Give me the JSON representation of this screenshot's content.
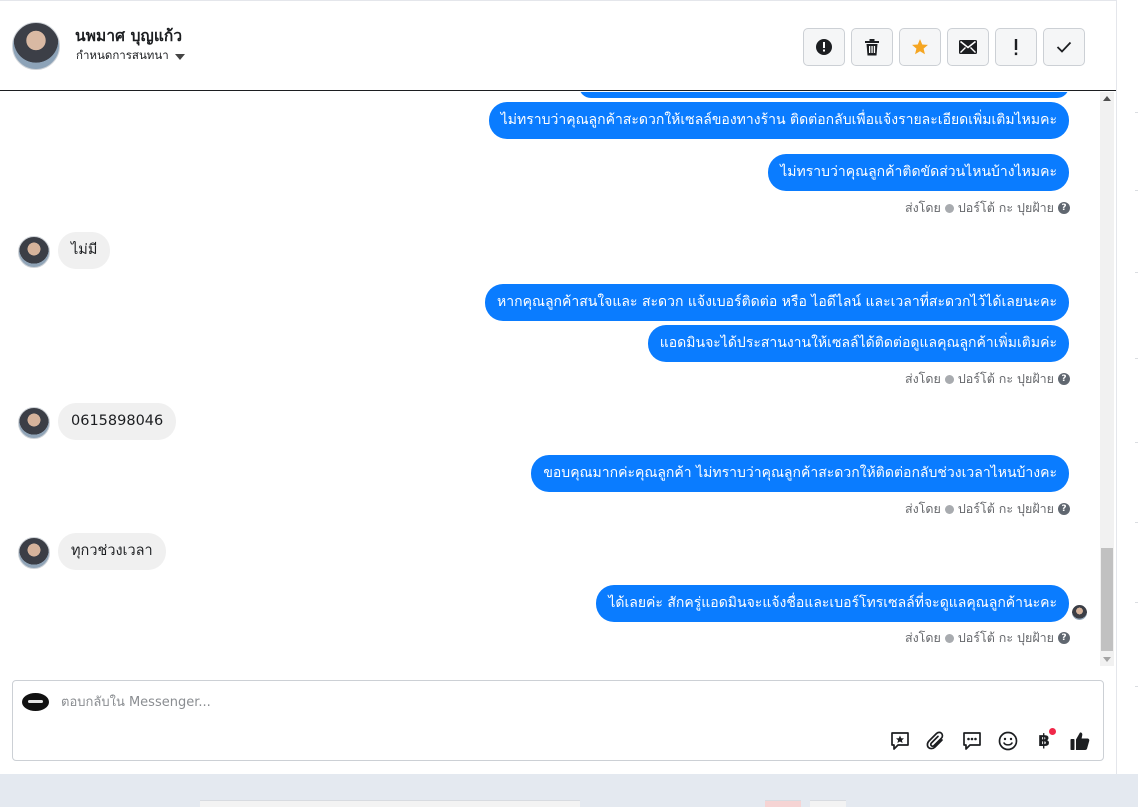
{
  "header": {
    "contact_name": "นพมาศ บุญแก้ว",
    "assign_label": "กำหนดการสนทนา",
    "actions": [
      {
        "name": "spam-button",
        "icon": "alert-circle-icon"
      },
      {
        "name": "delete-button",
        "icon": "trash-icon"
      },
      {
        "name": "star-button",
        "icon": "star-icon",
        "color": "#f5a623"
      },
      {
        "name": "mark-unread-button",
        "icon": "envelope-icon"
      },
      {
        "name": "follow-up-button",
        "icon": "exclamation-icon"
      },
      {
        "name": "mark-done-button",
        "icon": "checkmark-icon"
      }
    ]
  },
  "messages": {
    "out_1": "ไม่ทราบว่าคุณลูกค้าสะดวกให้เซลล์ของทางร้าน ติดต่อกลับเพื่อแจ้งรายละเอียดเพิ่มเติมไหมคะ",
    "out_2": "ไม่ทราบว่าคุณลูกค้าติดขัดส่วนไหนบ้างไหมคะ",
    "in_1": "ไม่มี",
    "out_3": "หากคุณลูกค้าสนใจและ สะดวก แจ้งเบอร์ติดต่อ หรือ ไอดีไลน์ และเวลาที่สะดวกไว้ได้เลยนะคะ",
    "out_4": "แอดมินจะได้ประสานงานให้เซลล์ได้ติดต่อดูแลคุณลูกค้าเพิ่มเติมค่ะ",
    "in_2": "0615898046",
    "out_5": "ขอบคุณมากค่ะคุณลูกค้า ไม่ทราบว่าคุณลูกค้าสะดวกให้ติดต่อกลับช่วงเวลาไหนบ้างคะ",
    "in_3": "ทุกวช่วงเวลา",
    "out_6": "ได้เลยค่ะ สักครู่แอดมินจะแจ้งชื่อและเบอร์โทรเซลล์ที่จะดูแลคุณลูกค้านะคะ"
  },
  "sent_by": {
    "prefix": "ส่งโดย",
    "sender": "ปอร์โต้ กะ ปุยฝ้าย",
    "help": "?"
  },
  "composer": {
    "placeholder": "ตอบกลับใน Messenger...",
    "tools": [
      "saved-reply-icon",
      "attachment-icon",
      "chat-bubble-icon",
      "emoji-icon",
      "baht-payment-icon",
      "thumbs-up-icon"
    ],
    "baht_symbol": "฿"
  },
  "colors": {
    "outgoing_bubble": "#0a7cff",
    "incoming_bubble": "#f0f0f0",
    "notification_dot": "#f02849"
  }
}
